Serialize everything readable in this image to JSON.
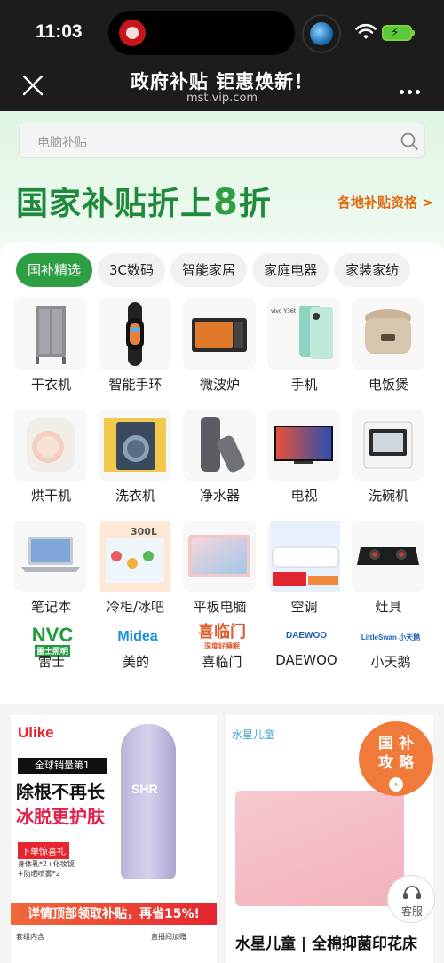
{
  "status": {
    "time": "11:03",
    "icons": [
      "wifi-icon",
      "battery-charging-icon"
    ]
  },
  "nav": {
    "title": "政府补贴 钜惠焕新！",
    "subtitle": "mst.vip.com",
    "icons": [
      "close-icon",
      "more-icon"
    ]
  },
  "hero": {
    "search_placeholder": "电脑补贴",
    "title_prefix": "国家补贴折上",
    "title_number": "8",
    "title_suffix": "折",
    "link": "各地补贴资格 >",
    "colors": {
      "green": "#2e9e43",
      "orange": "#e06a10"
    }
  },
  "tabs": [
    "国补精选",
    "3C数码",
    "智能家居",
    "庭电器",
    "家装家纺"
  ],
  "tabs_fixed": [
    "国补精选",
    "3C数码",
    "智能家居",
    "家庭电器",
    "家装家纺"
  ],
  "categories": [
    {
      "label": "干衣机",
      "icon": "dryer-rack-icon"
    },
    {
      "label": "智能手环",
      "icon": "smart-band-icon"
    },
    {
      "label": "微波炉",
      "icon": "microwave-icon"
    },
    {
      "label": "手机",
      "icon": "phone-icon"
    },
    {
      "label": "电饭煲",
      "icon": "rice-cooker-icon"
    },
    {
      "label": "烘干机",
      "icon": "tumble-dryer-icon"
    },
    {
      "label": "洗衣机",
      "icon": "washing-machine-icon"
    },
    {
      "label": "净水器",
      "icon": "water-purifier-icon"
    },
    {
      "label": "电视",
      "icon": "tv-icon"
    },
    {
      "label": "洗碗机",
      "icon": "dishwasher-icon"
    },
    {
      "label": "笔记本",
      "icon": "laptop-icon"
    },
    {
      "label": "冷柜/冰吧",
      "icon": "freezer-icon"
    },
    {
      "label": "平板电脑",
      "icon": "tablet-icon"
    },
    {
      "label": "空调",
      "icon": "air-conditioner-icon"
    },
    {
      "label": "灶具",
      "icon": "stove-icon"
    }
  ],
  "freezer_tag": "300L",
  "brands": [
    {
      "name": "雷士",
      "logo_text": "NVC",
      "logo_sub": "雷士照明",
      "color": "#1f9a3c"
    },
    {
      "name": "美的",
      "logo_text": "Midea",
      "logo_sub": "",
      "color": "#1a8fd6"
    },
    {
      "name": "喜临门",
      "logo_text": "喜临门",
      "logo_sub": "深度好睡眠",
      "color": "#e0572a"
    },
    {
      "name": "DAEWOO",
      "logo_text": "DAEWOO",
      "logo_sub": "",
      "color": "#1a5fb4"
    },
    {
      "name": "小天鹅",
      "logo_text": "LittleSwan 小天鹅",
      "logo_sub": "",
      "color": "#1a5fb4"
    }
  ],
  "promo_left": {
    "brand": "Ulike",
    "badge": "全球销量第1",
    "headline1": "除根不再长",
    "headline2": "冰脱更护肤",
    "tag": "下单惊喜礼",
    "small1": "身体乳*2+化妆镜",
    "small2": "+防晒喷雾*2",
    "device_label": "SHR",
    "banner": "详情顶部领取补贴，再省15%!",
    "foot1": "套组内含",
    "foot2": "直播间加赠"
  },
  "promo_right": {
    "brand": "水星儿童",
    "title": "水星儿童 | 全棉抑菌印花床"
  },
  "float_badge": {
    "line1": "国 补",
    "line2": "攻 略",
    "arrow": "›"
  },
  "service": {
    "label": "客服"
  }
}
